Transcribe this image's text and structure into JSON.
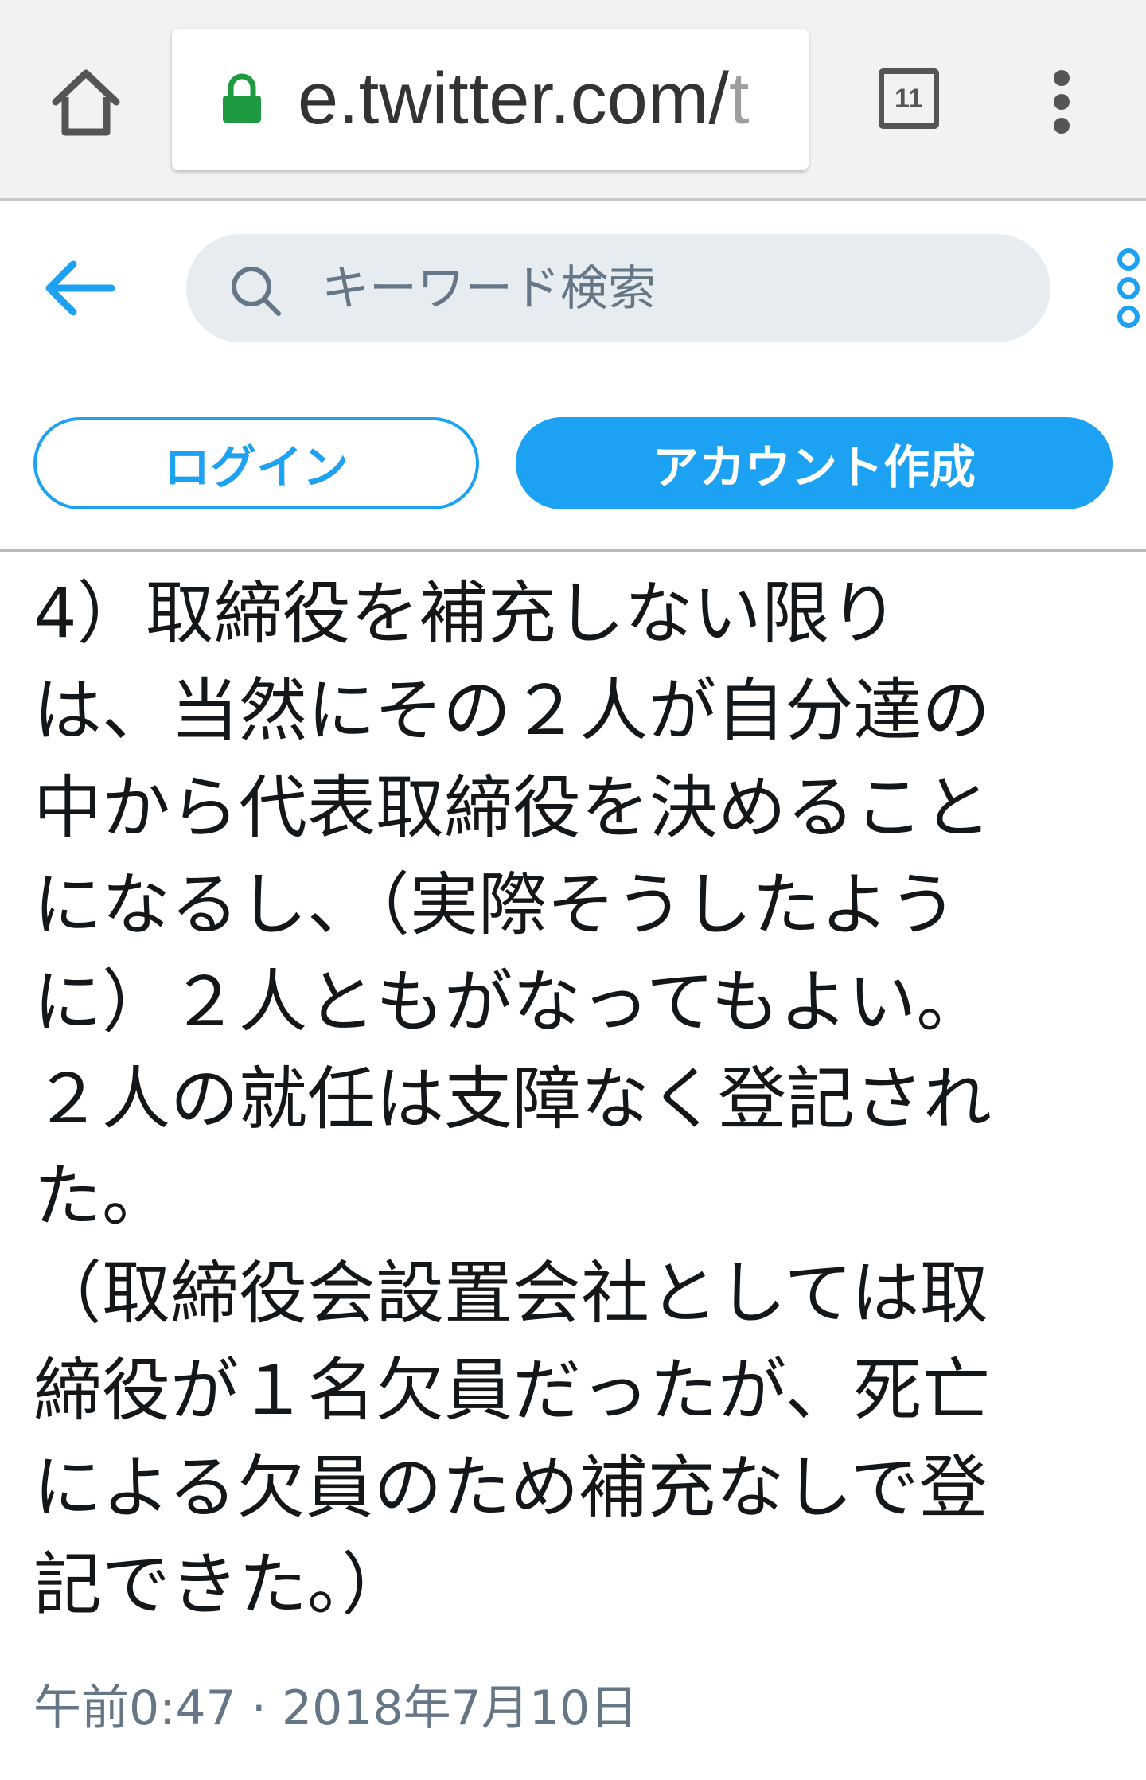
{
  "browser": {
    "url_host": "e.twitter.com/",
    "url_rest": "t",
    "tab_count": "11",
    "icons": {
      "home": "home-icon",
      "lock": "lock-icon",
      "menu": "kebab-menu-icon"
    },
    "lock_color": "#1e9a41"
  },
  "header": {
    "search_placeholder": "キーワード検索",
    "icons": {
      "back": "arrow-left-icon",
      "search": "search-icon",
      "more": "more-vertical-icon"
    },
    "accent_color": "#1da1f2"
  },
  "actions": {
    "login_label": "ログイン",
    "signup_label": "アカウント作成"
  },
  "tweet": {
    "lines": [
      "4）取締役を補充しない限り",
      "は、当然にその２人が自分達の",
      "中から代表取締役を決めること",
      "になるし、（実際そうしたよう",
      "に）２人ともがなってもよい。",
      "２人の就任は支障なく登記され",
      "た。",
      "（取締役会設置会社としては取",
      "締役が１名欠員だったが、死亡",
      "による欠員のため補充なしで登",
      "記できた。）"
    ],
    "timestamp": "午前0:47 · 2018年7月10日"
  }
}
